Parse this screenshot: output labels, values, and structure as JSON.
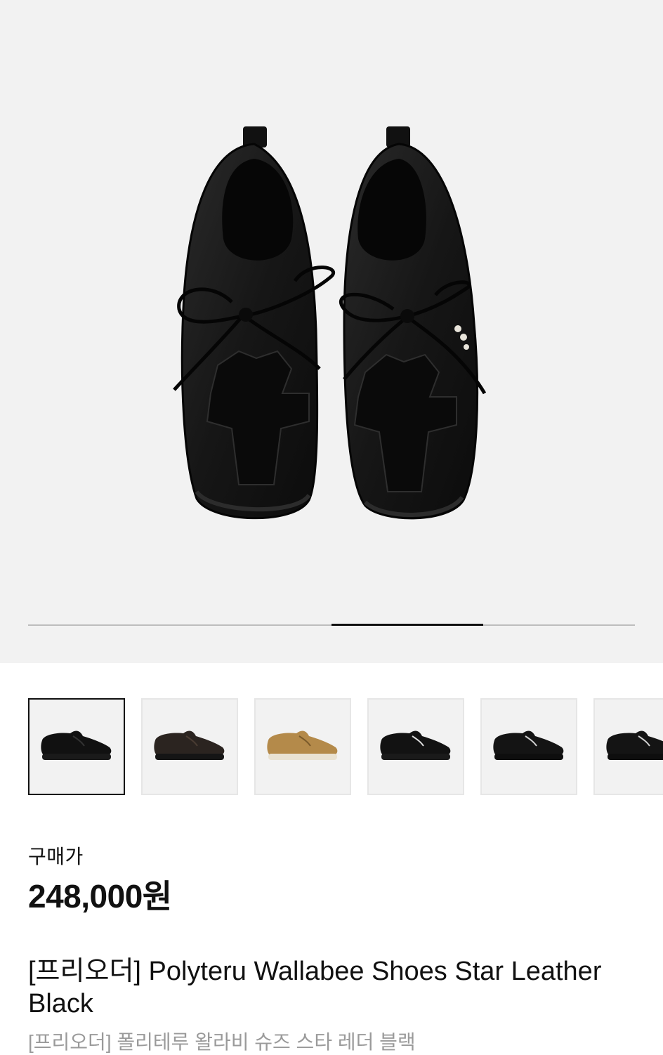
{
  "gallery": {
    "image_count": 4,
    "current_index": 3,
    "colors": {
      "track": "#bdbdbd",
      "active": "#111111",
      "background": "#f2f2f2"
    }
  },
  "thumbnails": [
    {
      "variant": "black",
      "selected": true
    },
    {
      "variant": "dark-brown",
      "selected": false
    },
    {
      "variant": "tan-suede",
      "selected": false
    },
    {
      "variant": "black-star",
      "selected": false
    },
    {
      "variant": "black-suede",
      "selected": false
    },
    {
      "variant": "black-suede",
      "selected": false
    }
  ],
  "purchase": {
    "label": "구매가",
    "price": "248,000원"
  },
  "product": {
    "title": "[프리오더] Polyteru Wallabee Shoes Star Leather Black",
    "subtitle": "[프리오더] 폴리테루 왈라비 슈즈 스타 레더 블랙"
  }
}
